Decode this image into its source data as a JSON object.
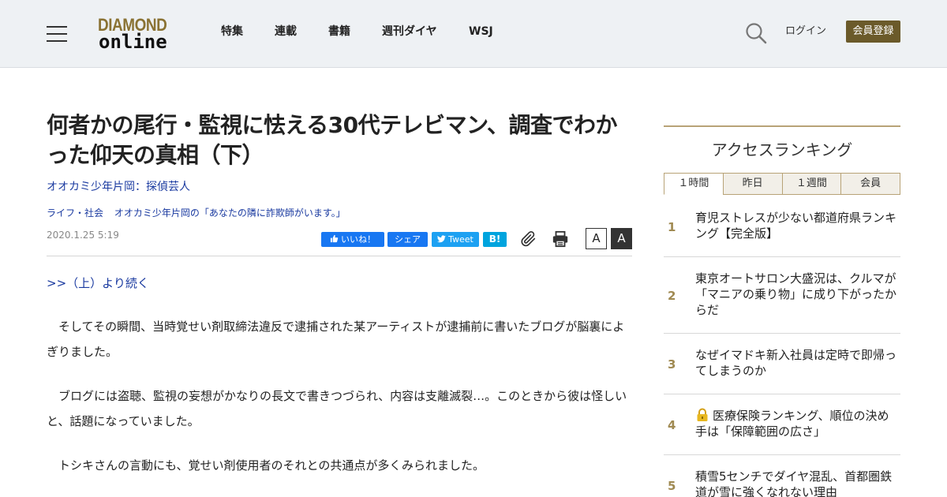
{
  "header": {
    "logo_top": "DIAMOND",
    "logo_bottom": "online",
    "nav": [
      "特集",
      "連載",
      "書籍",
      "週刊ダイヤ",
      "WSJ"
    ],
    "login": "ログイン",
    "register": "会員登録"
  },
  "article": {
    "title": "何者かの尾行・監視に怯える30代テレビマン、調査でわかった仰天の真相（下）",
    "author": "オオカミ少年片岡：探偵芸人",
    "category": "ライフ・社会",
    "series": "オオカミ少年片岡の「あなたの隣に詐欺師がいます。」",
    "date": "2020.1.25 5:19",
    "share": {
      "like": "いいね！",
      "share": "シェア",
      "tweet": "Tweet",
      "hatena": "B!"
    },
    "font_small": "A",
    "font_large": "A",
    "prev_link": ">>（上）より続く",
    "paragraphs": [
      "　そしてその瞬間、当時覚せい剤取締法違反で逮捕された某アーティストが逮捕前に書いたブログが脳裏によぎりました。",
      "　ブログには盗聴、監視の妄想がかなりの長文で書きつづられ、内容は支離滅裂…。このときから彼は怪しいと、話題になっていました。",
      "　トシキさんの言動にも、覚せい剤使用者のそれとの共通点が多くみられました。"
    ]
  },
  "sidebar": {
    "title": "アクセスランキング",
    "tabs": [
      "１時間",
      "昨日",
      "１週間",
      "会員"
    ],
    "active_tab": "１時間",
    "ranking": [
      {
        "rank": "1",
        "text": "育児ストレスが少ない都道府県ランキング【完全版】",
        "locked": false
      },
      {
        "rank": "2",
        "text": "東京オートサロン大盛況は、クルマが「マニアの乗り物」に成り下がったからだ",
        "locked": false
      },
      {
        "rank": "3",
        "text": "なぜイマドキ新入社員は定時で即帰ってしまうのか",
        "locked": false
      },
      {
        "rank": "4",
        "text": "医療保険ランキング、順位の決め手は「保障範囲の広さ」",
        "locked": true
      },
      {
        "rank": "5",
        "text": "積雪5センチでダイヤ混乱、首都圏鉄道が雪に強くなれない理由",
        "locked": false
      }
    ]
  },
  "colors": {
    "header_bg": "#eef1f4",
    "accent_gold": "#a08a52",
    "register_bg": "#6b5a2a",
    "link_blue": "#1a3aa0",
    "facebook": "#1877f2",
    "twitter": "#1da1f2",
    "hatena": "#00a4de"
  }
}
